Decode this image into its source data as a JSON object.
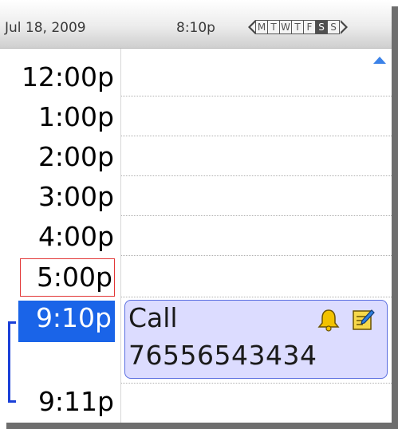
{
  "header": {
    "date": "Jul 18, 2009",
    "time": "8:10p",
    "week_days": [
      {
        "label": "M",
        "active": false
      },
      {
        "label": "T",
        "active": false
      },
      {
        "label": "W",
        "active": false
      },
      {
        "label": "T",
        "active": false
      },
      {
        "label": "F",
        "active": false
      },
      {
        "label": "S",
        "active": true
      },
      {
        "label": "S",
        "active": false
      }
    ]
  },
  "time_slots": [
    "12:00p",
    "1:00p",
    "2:00p",
    "3:00p",
    "4:00p",
    "5:00p",
    "9:10p",
    "9:11p"
  ],
  "focused_slot": "5:00p",
  "selected_slot": "9:10p",
  "event": {
    "title": "Call",
    "body": "76556543434",
    "icons": [
      "alarm-bell-icon",
      "notes-icon"
    ],
    "background_color": "#dcdcff",
    "border_color": "#5a6ee0"
  },
  "colors": {
    "selection": "#1a64e8",
    "focus_border": "#e23636",
    "duration_marker": "#1a40d8"
  }
}
